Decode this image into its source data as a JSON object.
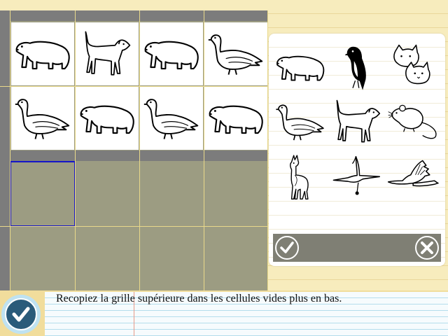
{
  "instruction": "Recopiez la grille supérieure dans les cellules vides plus en bas.",
  "model_grid": {
    "row1": [
      "polar-bear",
      "dog",
      "polar-bear",
      "goose"
    ],
    "row2": [
      "goose",
      "polar-bear",
      "goose",
      "polar-bear"
    ]
  },
  "answer_grid": {
    "row1": [
      "",
      "",
      "",
      ""
    ],
    "row2": [
      "",
      "",
      "",
      ""
    ],
    "selected_cell": "row1-col1"
  },
  "palette": {
    "items": [
      "polar-bear",
      "bird",
      "kitten",
      "goose",
      "dog",
      "rat",
      "llama",
      "crane",
      "swan"
    ],
    "ok_icon": "check-icon",
    "cancel_icon": "cancel-icon"
  },
  "colors": {
    "selection": "#1414c8",
    "empty_cell": "#9c9c82",
    "band": "#7c7c7c"
  }
}
